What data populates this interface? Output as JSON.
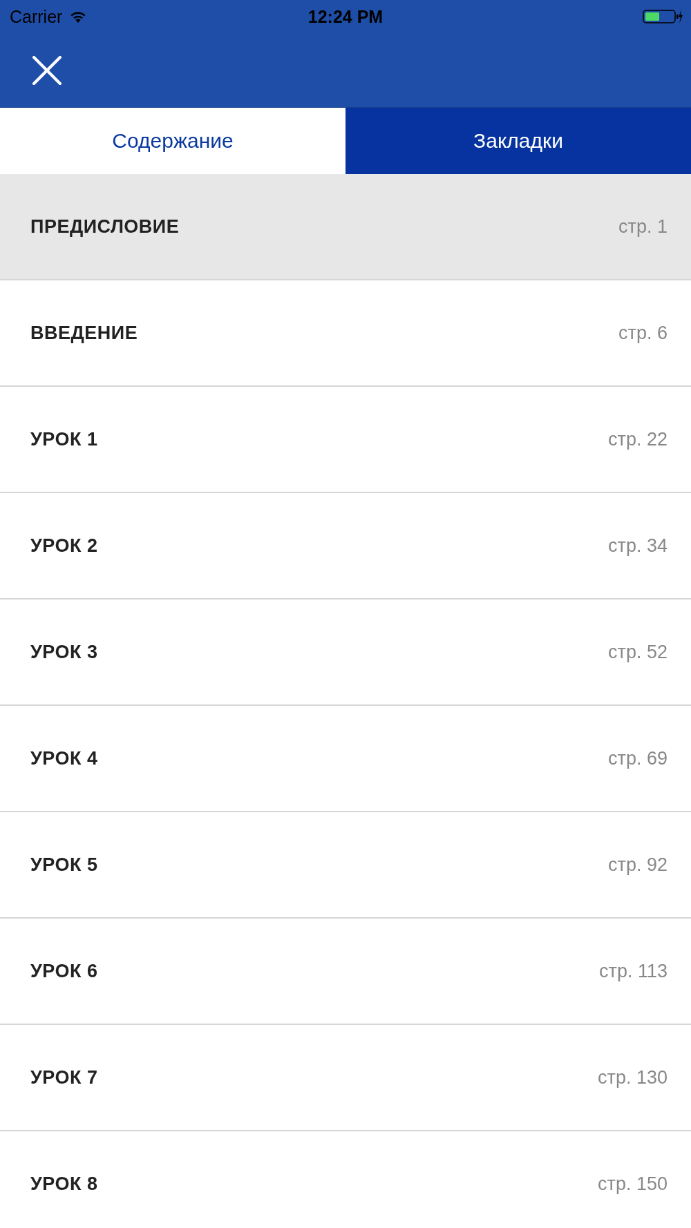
{
  "status_bar": {
    "carrier": "Carrier",
    "time": "12:24 PM"
  },
  "tabs": [
    {
      "label": "Содержание",
      "selected": true
    },
    {
      "label": "Закладки",
      "selected": false
    }
  ],
  "contents": [
    {
      "title": "ПРЕДИСЛОВИЕ",
      "page": "стр. 1",
      "selected": true
    },
    {
      "title": "ВВЕДЕНИЕ",
      "page": "стр. 6",
      "selected": false
    },
    {
      "title": "УРОК 1",
      "page": "стр. 22",
      "selected": false
    },
    {
      "title": "УРОК 2",
      "page": "стр. 34",
      "selected": false
    },
    {
      "title": "УРОК 3",
      "page": "стр. 52",
      "selected": false
    },
    {
      "title": "УРОК 4",
      "page": "стр. 69",
      "selected": false
    },
    {
      "title": "УРОК 5",
      "page": "стр. 92",
      "selected": false
    },
    {
      "title": "УРОК 6",
      "page": "стр. 113",
      "selected": false
    },
    {
      "title": "УРОК 7",
      "page": "стр. 130",
      "selected": false
    },
    {
      "title": "УРОК 8",
      "page": "стр. 150",
      "selected": false
    }
  ]
}
